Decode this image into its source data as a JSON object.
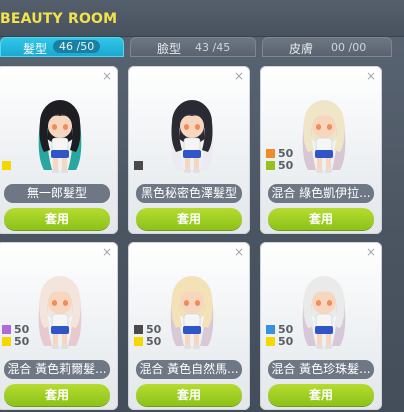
{
  "window": {
    "title": "BEAUTY ROOM"
  },
  "tabs": [
    {
      "label": "髮型",
      "count": "46 /50",
      "active": true
    },
    {
      "label": "臉型",
      "count": "43 /45",
      "active": false
    },
    {
      "label": "皮膚",
      "count": "00 /00",
      "active": false
    }
  ],
  "cards": [
    {
      "name": "無一郎髮型",
      "apply": "套用",
      "close": "×",
      "mix": [
        {
          "color": "#f5d800",
          "value": ""
        }
      ],
      "hair": "#1d1d22",
      "hair2": "#2aa6a0"
    },
    {
      "name": "黑色秘密色澤髮型",
      "apply": "套用",
      "close": "×",
      "mix": [
        {
          "color": "#4a4a4a",
          "value": ""
        }
      ],
      "hair": "#2a2a33",
      "hair2": "#ecebf2"
    },
    {
      "name": "混合 綠色凱伊拉...",
      "apply": "套用",
      "close": "×",
      "mix": [
        {
          "color": "#f08b2c",
          "value": "50"
        },
        {
          "color": "#98c21b",
          "value": "50"
        }
      ],
      "hair": "#efe6c8",
      "hair2": "#d8c7d2"
    },
    {
      "name": "混合 黃色莉爾髮...",
      "apply": "套用",
      "close": "×",
      "mix": [
        {
          "color": "#b06ad8",
          "value": "50"
        },
        {
          "color": "#f5d800",
          "value": "50"
        }
      ],
      "hair": "#f3e5dc",
      "hair2": "#e8c9cf"
    },
    {
      "name": "混合 黃色自然馬...",
      "apply": "套用",
      "close": "×",
      "mix": [
        {
          "color": "#4a4a4a",
          "value": "50"
        },
        {
          "color": "#f5d800",
          "value": "50"
        }
      ],
      "hair": "#f4e2b6",
      "hair2": "#d8c9d9"
    },
    {
      "name": "混合 黃色珍珠髮...",
      "apply": "套用",
      "close": "×",
      "mix": [
        {
          "color": "#3b8fe0",
          "value": "50"
        },
        {
          "color": "#f5d800",
          "value": "50"
        }
      ],
      "hair": "#eaeaea",
      "hair2": "#d6c8d8"
    }
  ]
}
